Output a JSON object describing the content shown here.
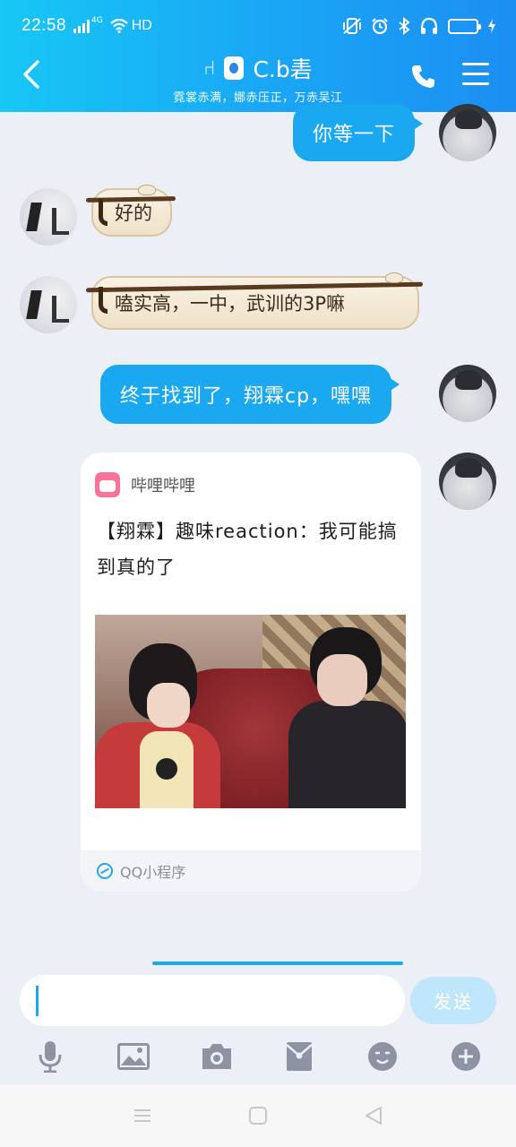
{
  "status_bar": {
    "time": "22:58",
    "network": "4G",
    "hd_label": "HD",
    "battery_level": 0.85,
    "battery_color": "#ffd31a"
  },
  "header": {
    "title": "C.b砉",
    "subtitle": "霓裳赤满，娜赤压正，万赤吴江",
    "gradient_start": "#17c7f5",
    "gradient_end": "#1b8ff2"
  },
  "messages": [
    {
      "side": "right",
      "type": "text",
      "text": "你等一下"
    },
    {
      "side": "left",
      "type": "scroll-text",
      "text": "好的"
    },
    {
      "side": "left",
      "type": "scroll-text",
      "text": "嗑实高，一中，武训的3P嘛"
    },
    {
      "side": "right",
      "type": "text",
      "text": "终于找到了，翔霖cp，嘿嘿"
    },
    {
      "side": "right",
      "type": "mini-program-card",
      "source": "哔哩哔哩",
      "title": "【翔霖】趣味reaction：我可能搞到真的了",
      "footer": "QQ小程序"
    }
  ],
  "input": {
    "placeholder": "",
    "value": "",
    "send_label": "发送"
  },
  "toolbar": [
    "mic-icon",
    "image-icon",
    "camera-icon",
    "red-packet-icon",
    "emoji-icon",
    "plus-icon"
  ],
  "accent": "#1aa8f0"
}
